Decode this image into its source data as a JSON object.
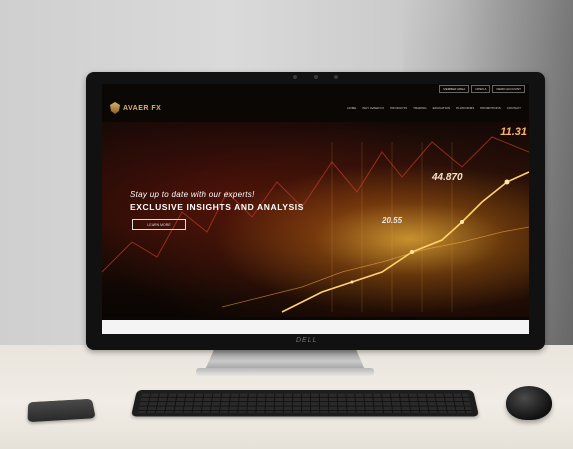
{
  "website": {
    "brand": "AVAER FX",
    "top_links": [
      "MEMBER AREA",
      "OPEN A",
      "DEMO ACCOUNT"
    ],
    "nav_items": [
      "HOME",
      "WHY AVAER FX",
      "PRODUCTS",
      "TRADING",
      "EDUCATION",
      "PLATFORMS",
      "PROMOTIONS",
      "CONTACT"
    ],
    "hero": {
      "subtitle": "Stay up to date with our experts!",
      "title": "EXCLUSIVE INSIGHTS AND ANALYSIS",
      "button_label": "LEARN MORE",
      "numbers": [
        "11.31",
        "44.870",
        "20.55"
      ]
    }
  },
  "monitor": {
    "brand": "DELL"
  },
  "colors": {
    "accent_gold": "#d9b374",
    "hero_glow": "#ffbe3c",
    "bezel": "#111111"
  }
}
